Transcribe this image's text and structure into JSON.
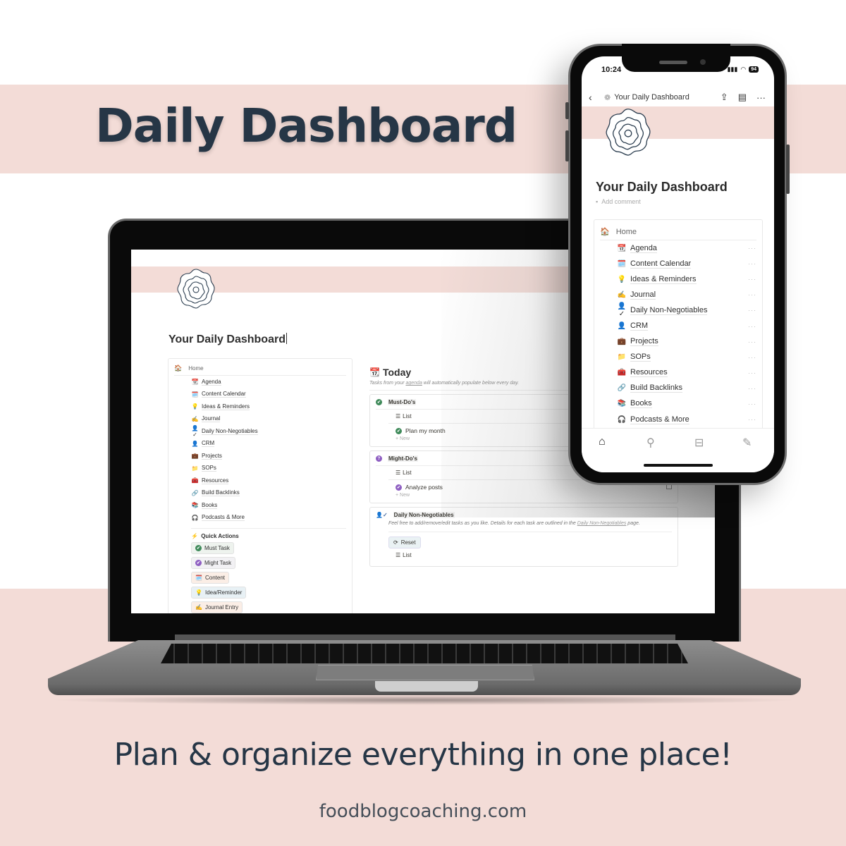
{
  "promo": {
    "headline": "Daily Dashboard",
    "tagline": "Plan & organize everything in one place!",
    "website": "foodblogcoaching.com",
    "colors": {
      "band": "#f3dcd7",
      "text": "#263646"
    }
  },
  "laptop_page": {
    "title": "Your Daily Dashboard",
    "icon": "flower-outline-icon",
    "nav": {
      "home_label": "Home",
      "home_icon": "🏠",
      "items": [
        {
          "icon": "📆",
          "label": "Agenda"
        },
        {
          "icon": "🗓️",
          "label": "Content Calendar"
        },
        {
          "icon": "💡",
          "label": "Ideas & Reminders"
        },
        {
          "icon": "✍️",
          "label": "Journal"
        },
        {
          "icon": "👤✓",
          "label": "Daily Non-Negotiables"
        },
        {
          "icon": "👤",
          "label": "CRM"
        },
        {
          "icon": "💼",
          "label": "Projects"
        },
        {
          "icon": "📁",
          "label": "SOPs"
        },
        {
          "icon": "🧰",
          "label": "Resources"
        },
        {
          "icon": "🔗",
          "label": "Build Backlinks"
        },
        {
          "icon": "📚",
          "label": "Books"
        },
        {
          "icon": "🎧",
          "label": "Podcasts & More"
        }
      ]
    },
    "quick_actions": {
      "title": "Quick Actions",
      "icon": "⚡",
      "buttons": [
        {
          "icon": "✔",
          "label": "Must Task"
        },
        {
          "icon": "✔",
          "label": "Might Task"
        },
        {
          "icon": "🗓️",
          "label": "Content"
        },
        {
          "icon": "💡",
          "label": "Idea/Reminder"
        },
        {
          "icon": "✍️",
          "label": "Journal Entry"
        }
      ]
    },
    "today": {
      "icon": "📆",
      "title": "Today",
      "subtitle_pre": "Tasks from your ",
      "subtitle_link": "agenda",
      "subtitle_post": " will automatically populate below every day.",
      "must": {
        "title": "Must-Do's",
        "view": "List",
        "tasks": [
          "Plan my month"
        ],
        "new_label": "New"
      },
      "might": {
        "title": "Might-Do's",
        "view": "List",
        "tasks": [
          "Analyze posts"
        ],
        "new_label": "New"
      },
      "non_neg": {
        "title": "Daily Non-Negotiables",
        "desc_pre": "Feel free to add/remove/edit tasks as you like. Details for each task are outlined in the ",
        "desc_link": "Daily Non-Negotiables",
        "desc_post": " page.",
        "reset_label": "Reset",
        "view": "List"
      }
    }
  },
  "phone_page": {
    "status": {
      "time": "10:24",
      "battery": "94"
    },
    "nav_title": "Your Daily Dashboard",
    "title": "Your Daily Dashboard",
    "add_comment": "Add comment",
    "nav": {
      "home_label": "Home",
      "home_icon": "🏠",
      "more_label": "···",
      "items": [
        {
          "icon": "📆",
          "label": "Agenda"
        },
        {
          "icon": "🗓️",
          "label": "Content Calendar"
        },
        {
          "icon": "💡",
          "label": "Ideas & Reminders"
        },
        {
          "icon": "✍️",
          "label": "Journal"
        },
        {
          "icon": "👤✓",
          "label": "Daily Non-Negotiables"
        },
        {
          "icon": "👤",
          "label": "CRM"
        },
        {
          "icon": "💼",
          "label": "Projects"
        },
        {
          "icon": "📁",
          "label": "SOPs"
        },
        {
          "icon": "🧰",
          "label": "Resources"
        },
        {
          "icon": "🔗",
          "label": "Build Backlinks"
        },
        {
          "icon": "📚",
          "label": "Books"
        },
        {
          "icon": "🎧",
          "label": "Podcasts & More"
        }
      ]
    },
    "tabbar": [
      "home-icon",
      "search-icon",
      "inbox-icon",
      "compose-icon"
    ]
  }
}
